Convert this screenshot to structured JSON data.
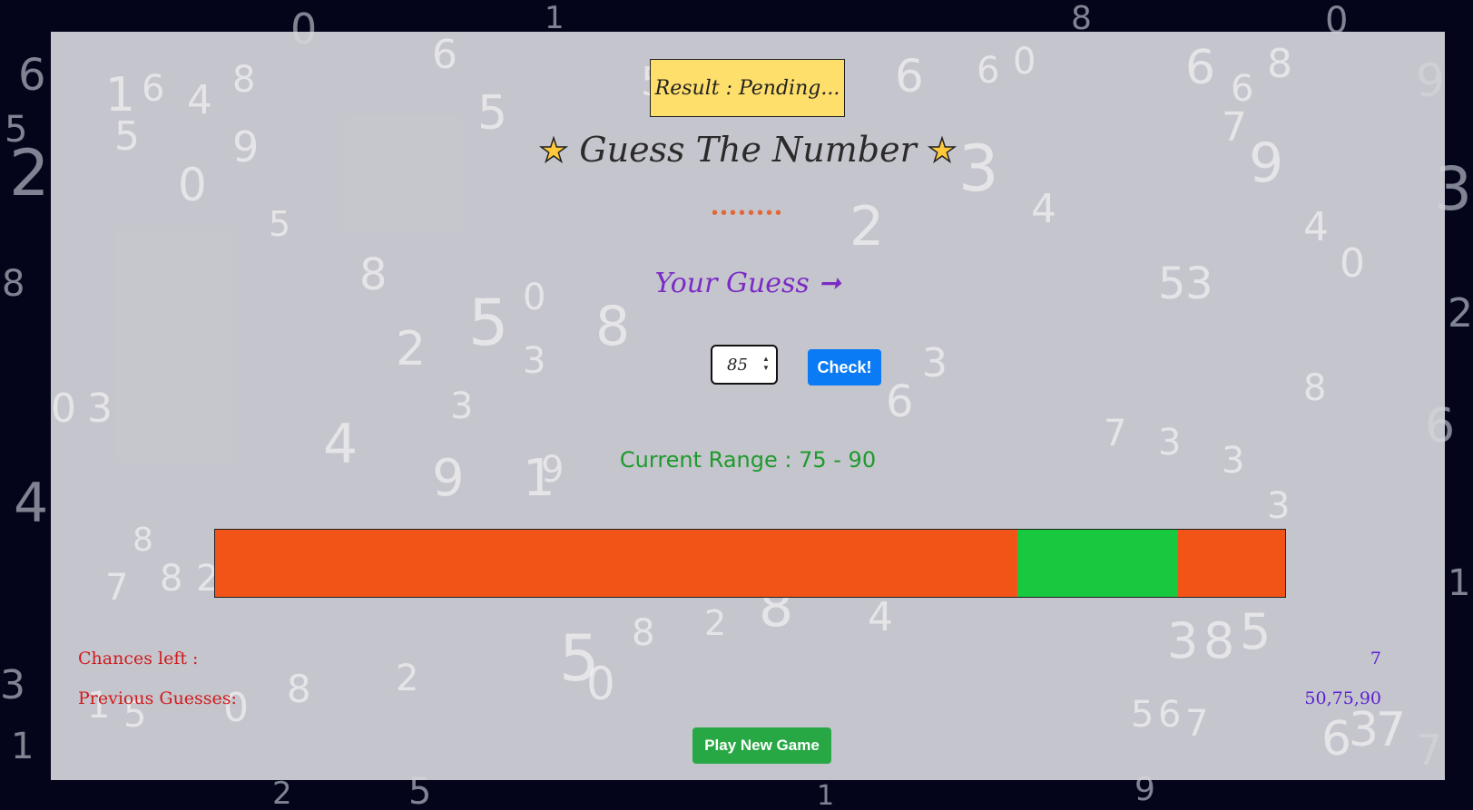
{
  "result": "Result : Pending...",
  "title": "Guess The Number",
  "title_star": "★",
  "title_dots": "••••••••",
  "guess_label": "Your Guess ➞",
  "guess_input_value": "85",
  "check_label": "Check!",
  "range_text": "Current Range : 75 - 90",
  "range_bar": {
    "min": 0,
    "max": 100,
    "low": 75,
    "high": 90,
    "colors": {
      "out": "#f25317",
      "in": "#18c940"
    }
  },
  "chances_label": "Chances left :",
  "chances_value": "7",
  "previous_label": "Previous Guesses:",
  "previous_value": "50,75,90",
  "new_game_label": "Play New Game"
}
